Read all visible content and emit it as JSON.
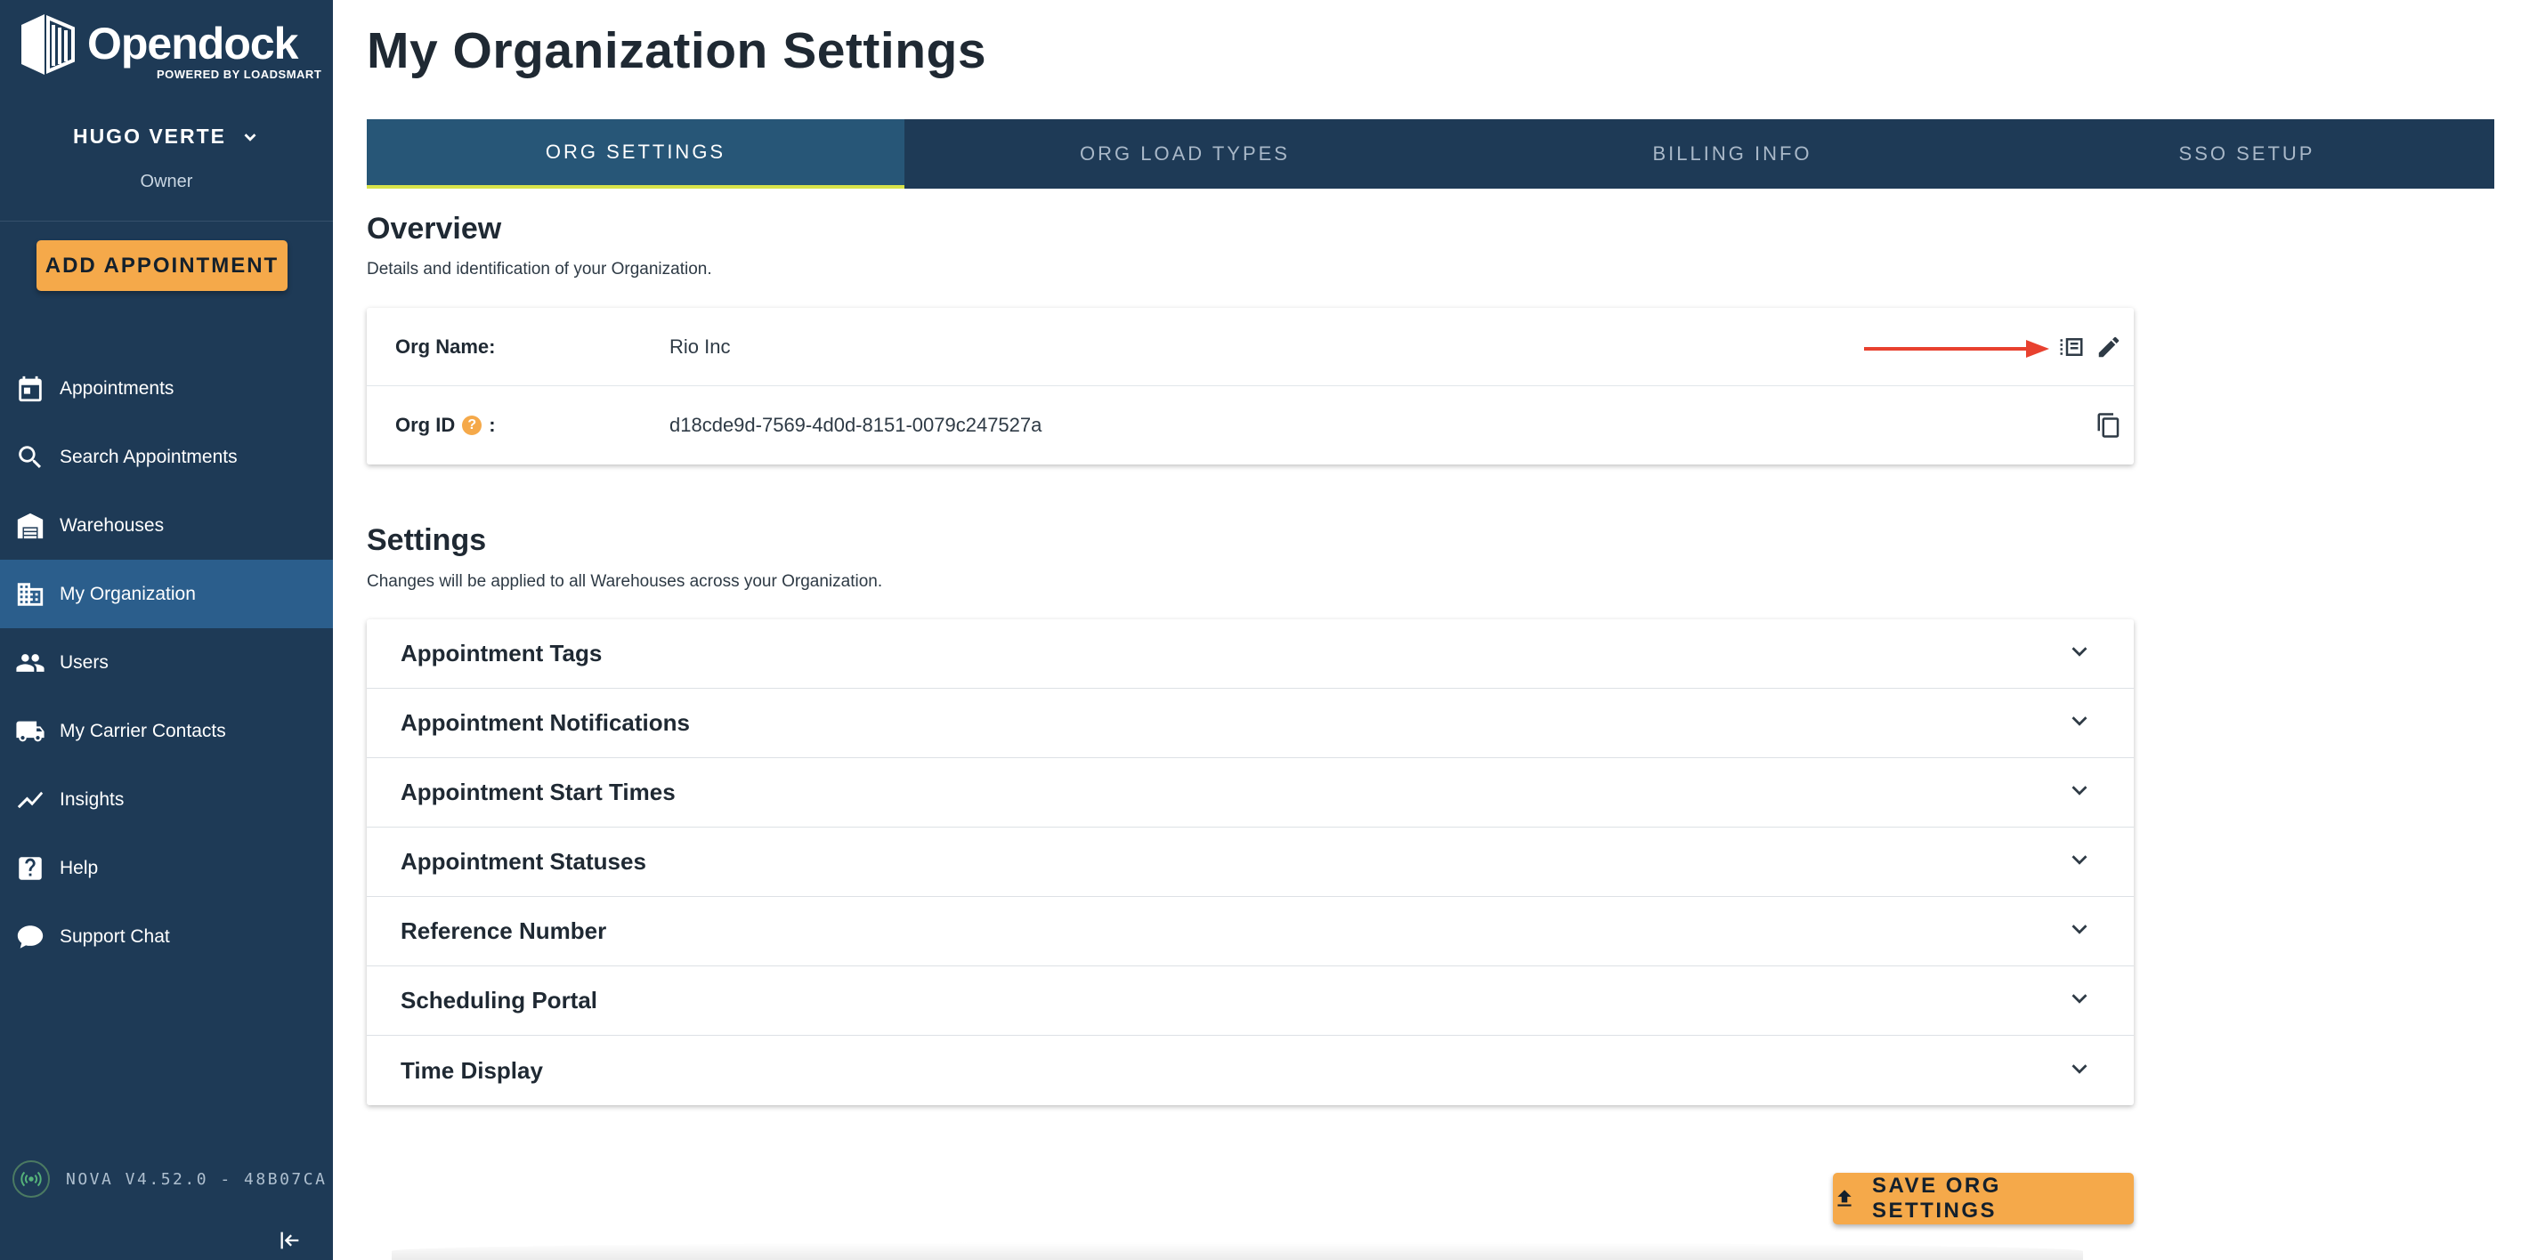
{
  "brand": {
    "name": "Opendock",
    "tagline": "POWERED BY LOADSMART"
  },
  "user": {
    "name": "HUGO VERTE",
    "role": "Owner"
  },
  "sidebar": {
    "add_appointment": "ADD APPOINTMENT",
    "items": [
      {
        "label": "Appointments",
        "icon": "calendar-icon",
        "active": false
      },
      {
        "label": "Search Appointments",
        "icon": "search-icon",
        "active": false
      },
      {
        "label": "Warehouses",
        "icon": "warehouse-icon",
        "active": false
      },
      {
        "label": "My Organization",
        "icon": "building-icon",
        "active": true
      },
      {
        "label": "Users",
        "icon": "users-icon",
        "active": false
      },
      {
        "label": "My Carrier Contacts",
        "icon": "truck-icon",
        "active": false
      },
      {
        "label": "Insights",
        "icon": "chart-line-icon",
        "active": false
      },
      {
        "label": "Help",
        "icon": "help-icon",
        "active": false
      },
      {
        "label": "Support Chat",
        "icon": "chat-icon",
        "active": false
      }
    ],
    "version": "NOVA V4.52.0 - 48B07CA"
  },
  "page": {
    "title": "My Organization Settings"
  },
  "tabs": [
    {
      "label": "ORG SETTINGS",
      "active": true
    },
    {
      "label": "ORG LOAD TYPES",
      "active": false
    },
    {
      "label": "BILLING INFO",
      "active": false
    },
    {
      "label": "SSO SETUP",
      "active": false
    }
  ],
  "overview": {
    "title": "Overview",
    "description": "Details and identification of your Organization.",
    "org_name_label": "Org Name:",
    "org_name_value": "Rio Inc",
    "org_id_label": "Org ID",
    "org_id_suffix": ":",
    "org_id_value": "d18cde9d-7569-4d0d-8151-0079c247527a"
  },
  "settings": {
    "title": "Settings",
    "description": "Changes will be applied to all Warehouses across your Organization.",
    "sections": [
      "Appointment Tags",
      "Appointment Notifications",
      "Appointment Start Times",
      "Appointment Statuses",
      "Reference Number",
      "Scheduling Portal",
      "Time Display"
    ]
  },
  "actions": {
    "save": "SAVE ORG SETTINGS"
  },
  "colors": {
    "sidebar_bg": "#1e3a56",
    "active_nav": "#2b5e8c",
    "accent_orange": "#f5a94a",
    "tab_indicator": "#d7e24a",
    "annotation_arrow": "#e8412f"
  }
}
